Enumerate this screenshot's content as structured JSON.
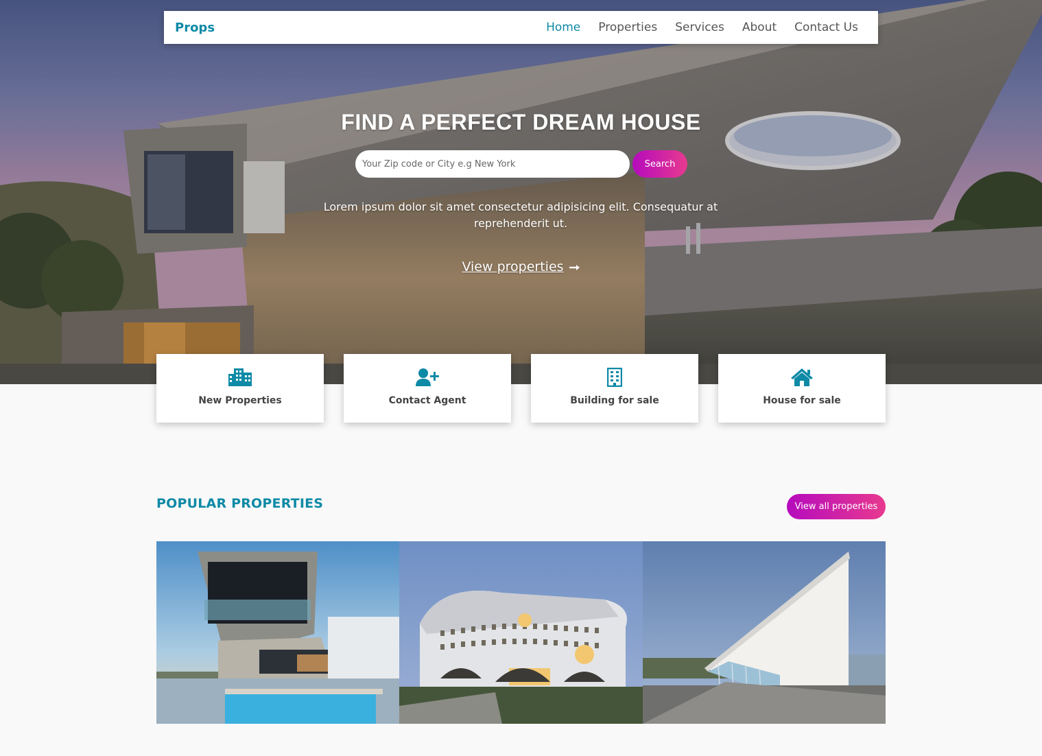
{
  "nav": {
    "brand": "Props",
    "links": [
      "Home",
      "Properties",
      "Services",
      "About",
      "Contact Us"
    ],
    "active": "Home"
  },
  "hero": {
    "title": "FIND A PERFECT DREAM HOUSE",
    "search_placeholder": "Your Zip code or City e.g New York",
    "search_button": "Search",
    "description": "Lorem ipsum dolor sit amet consectetur adipisicing elit. Consequatur at reprehenderit ut.",
    "cta": "View properties",
    "cta_icon": "arrow-right-icon"
  },
  "features": [
    {
      "label": "New Properties",
      "icon": "city-buildings-icon"
    },
    {
      "label": "Contact Agent",
      "icon": "user-plus-icon"
    },
    {
      "label": "Building for sale",
      "icon": "building-icon"
    },
    {
      "label": "House for sale",
      "icon": "home-icon"
    }
  ],
  "popular": {
    "title": "POPULAR PROPERTIES",
    "view_all": "View all properties",
    "photos": [
      "cantilever-house-photo",
      "arched-building-photo",
      "angular-hall-photo"
    ]
  },
  "colors": {
    "accent": "#0e8aa6",
    "gradient_start": "#b50bbd",
    "gradient_end": "#e83a8f",
    "page_background": "#f9f9f9"
  }
}
